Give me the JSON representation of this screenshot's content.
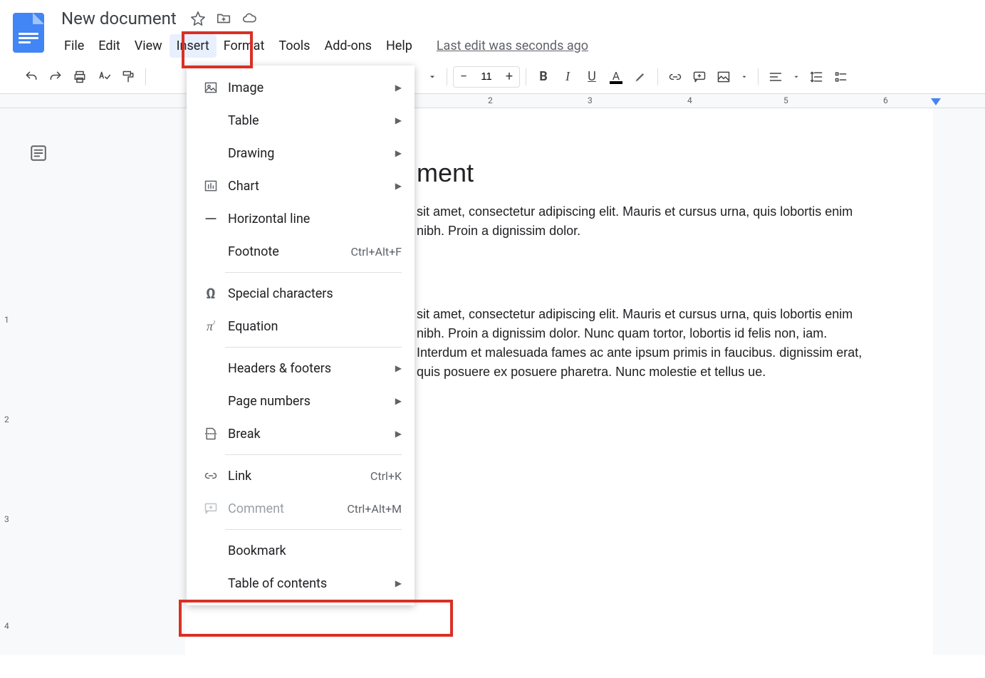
{
  "doc_title": "New document",
  "menus": [
    "File",
    "Edit",
    "View",
    "Insert",
    "Format",
    "Tools",
    "Add-ons",
    "Help"
  ],
  "active_menu_index": 3,
  "last_edit": "Last edit was seconds ago",
  "font_size": "11",
  "ruler_h": [
    "2",
    "3",
    "4",
    "5",
    "6"
  ],
  "ruler_v": [
    "1",
    "2",
    "3",
    "4"
  ],
  "insert_menu": {
    "groups": [
      [
        {
          "icon": "image",
          "label": "Image",
          "submenu": true
        },
        {
          "icon": "table",
          "label": "Table",
          "submenu": true
        },
        {
          "icon": "drawing",
          "label": "Drawing",
          "submenu": true
        },
        {
          "icon": "chart",
          "label": "Chart",
          "submenu": true
        },
        {
          "icon": "hr",
          "label": "Horizontal line"
        },
        {
          "icon": "",
          "label": "Footnote",
          "shortcut": "Ctrl+Alt+F"
        }
      ],
      [
        {
          "icon": "omega",
          "label": "Special characters"
        },
        {
          "icon": "pi",
          "label": "Equation"
        }
      ],
      [
        {
          "icon": "",
          "label": "Headers & footers",
          "submenu": true
        },
        {
          "icon": "",
          "label": "Page numbers",
          "submenu": true
        },
        {
          "icon": "break",
          "label": "Break",
          "submenu": true
        }
      ],
      [
        {
          "icon": "link",
          "label": "Link",
          "shortcut": "Ctrl+K"
        },
        {
          "icon": "comment",
          "label": "Comment",
          "shortcut": "Ctrl+Alt+M",
          "disabled": true
        }
      ],
      [
        {
          "icon": "",
          "label": "Bookmark"
        },
        {
          "icon": "",
          "label": "Table of contents",
          "submenu": true
        }
      ]
    ]
  },
  "document": {
    "heading": "ment",
    "p1": "sit amet, consectetur adipiscing elit. Mauris et cursus urna, quis lobortis enim nibh. Proin a dignissim dolor.",
    "p2": "sit amet, consectetur adipiscing elit. Mauris et cursus urna, quis lobortis enim nibh. Proin a dignissim dolor. Nunc quam tortor, lobortis id felis non, iam. Interdum et malesuada fames ac ante ipsum primis in faucibus. dignissim erat, quis posuere ex posuere pharetra. Nunc molestie et tellus ue."
  }
}
